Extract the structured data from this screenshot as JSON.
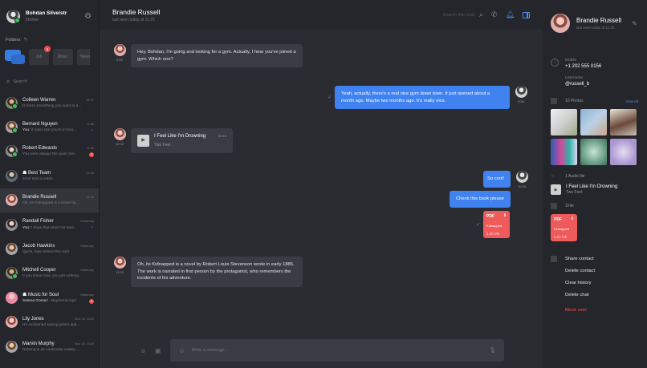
{
  "me": {
    "name": "Bohdan Silveistr",
    "status": "Online"
  },
  "folders": {
    "label": "Folders",
    "tabs": [
      {
        "label": "Job",
        "badge": "5"
      },
      {
        "label": "Music"
      },
      {
        "label": "News"
      }
    ]
  },
  "search": {
    "placeholder": "Search"
  },
  "contacts": [
    {
      "name": "Colleen Warren",
      "time": "12:47",
      "msg": "Is there something you want to a...",
      "prefix": "",
      "online": true,
      "unread": "",
      "tick": false,
      "pin": true
    },
    {
      "name": "Bernard Nguyen",
      "time": "11:58",
      "msg": "It looks like you're in trou...",
      "prefix": "You:",
      "online": true,
      "unread": "",
      "tick": true
    },
    {
      "name": "Robert Edwards",
      "time": "11:32",
      "msg": "You were always the quiet one.",
      "prefix": "",
      "online": true,
      "unread": "2",
      "tick": false
    },
    {
      "name": "Best Team",
      "time": "11:25",
      "msg": "John sent a video",
      "prefix": "",
      "online": false,
      "unread": "",
      "tick": false,
      "group": true
    },
    {
      "name": "Brandie Russell",
      "time": "11:20",
      "msg": "Oh, its Kidnapped is a novel by...",
      "prefix": "",
      "online": false,
      "unread": "",
      "tick": false,
      "selected": true
    },
    {
      "name": "Randall Fisher",
      "time": "Yesterday",
      "msg": "I hope that what I've said...",
      "prefix": "You:",
      "online": false,
      "unread": "",
      "tick": true
    },
    {
      "name": "Jacob Hawkins",
      "time": "Yesterday",
      "msg": "Quick, hide behind the sofa",
      "prefix": "",
      "online": false,
      "unread": "",
      "tick": false
    },
    {
      "name": "Mitchell Cooper",
      "time": "Yesterday",
      "msg": "If you leave now, you get nothing.",
      "prefix": "",
      "online": true,
      "unread": "",
      "tick": false
    },
    {
      "name": "Music for Soul",
      "time": "Yesterday",
      "msg": "Boyfriend.mp3",
      "prefix": "Selena Gomez -",
      "online": false,
      "unread": "9",
      "tick": false,
      "group": true
    },
    {
      "name": "Lily Jones",
      "time": "Nov 11, 2020",
      "msg": "He exclaimed seeing green app...",
      "prefix": "",
      "online": false,
      "unread": "",
      "tick": false
    },
    {
      "name": "Marvin Murphy",
      "time": "Nov 10, 2020",
      "msg": "Nothing is as cautiously cuddly...",
      "prefix": "",
      "online": false,
      "unread": "",
      "tick": false
    }
  ],
  "chat": {
    "name": "Brandie Russell",
    "last_seen": "last seen today at 11:25",
    "search_placeholder": "Search this chat",
    "messages": [
      {
        "dir": "in",
        "time": "9:40",
        "text": "Hey, Bohdan, I'm going and looking for a gym. Actually, I hear you've joined a gym. Which one?"
      },
      {
        "dir": "out",
        "time": "9:55",
        "text": "Yeah, actually, there's a real nice gym down town. It just opened about a month ago. Maybe two months ago. It's really nice."
      },
      {
        "dir": "in",
        "time": "10:02",
        "type": "audio",
        "title": "I Feel Like I'm Drowning",
        "artist": "Two Feet",
        "duration": "03:15"
      },
      {
        "dir": "out",
        "time": "10:05",
        "text": "So cool!"
      },
      {
        "dir": "out",
        "text": "Check this book please"
      },
      {
        "dir": "out",
        "type": "pdf",
        "label": "PDF",
        "name": "Kidnapped",
        "size": "1.55 Mb"
      },
      {
        "dir": "in",
        "time": "11:20",
        "text": "Oh, its Kidnapped is a novel by Robert Louis Stevenson wrote in early 1886. The work is narrated in first person by the protagonist, who remembers the incidents of his adventure."
      }
    ],
    "compose_placeholder": "Write a message..."
  },
  "profile": {
    "name": "Brandie Russell",
    "last_seen": "last seen today at 11:25",
    "mobile_label": "Mobile",
    "mobile": "+1 202 555 0156",
    "username_label": "Username",
    "username": "@russell_b",
    "photos_label": "10 Photos",
    "view_all": "View All",
    "audio_label": "1 Audio file",
    "audio_title": "I Feel Like I'm Drowning",
    "audio_artist": "Two Feet",
    "file_label": "1File",
    "file": {
      "label": "PDF",
      "name": "Kidnapped",
      "size": "1.55 Mb"
    },
    "actions": [
      "Share contact",
      "Delete contact",
      "Clear history",
      "Delete chat",
      "Block user"
    ]
  },
  "colors": {
    "accent": "#3f82f0",
    "danger": "#ef4d4d",
    "online": "#35c759",
    "pdf": "#ef5b5b"
  }
}
